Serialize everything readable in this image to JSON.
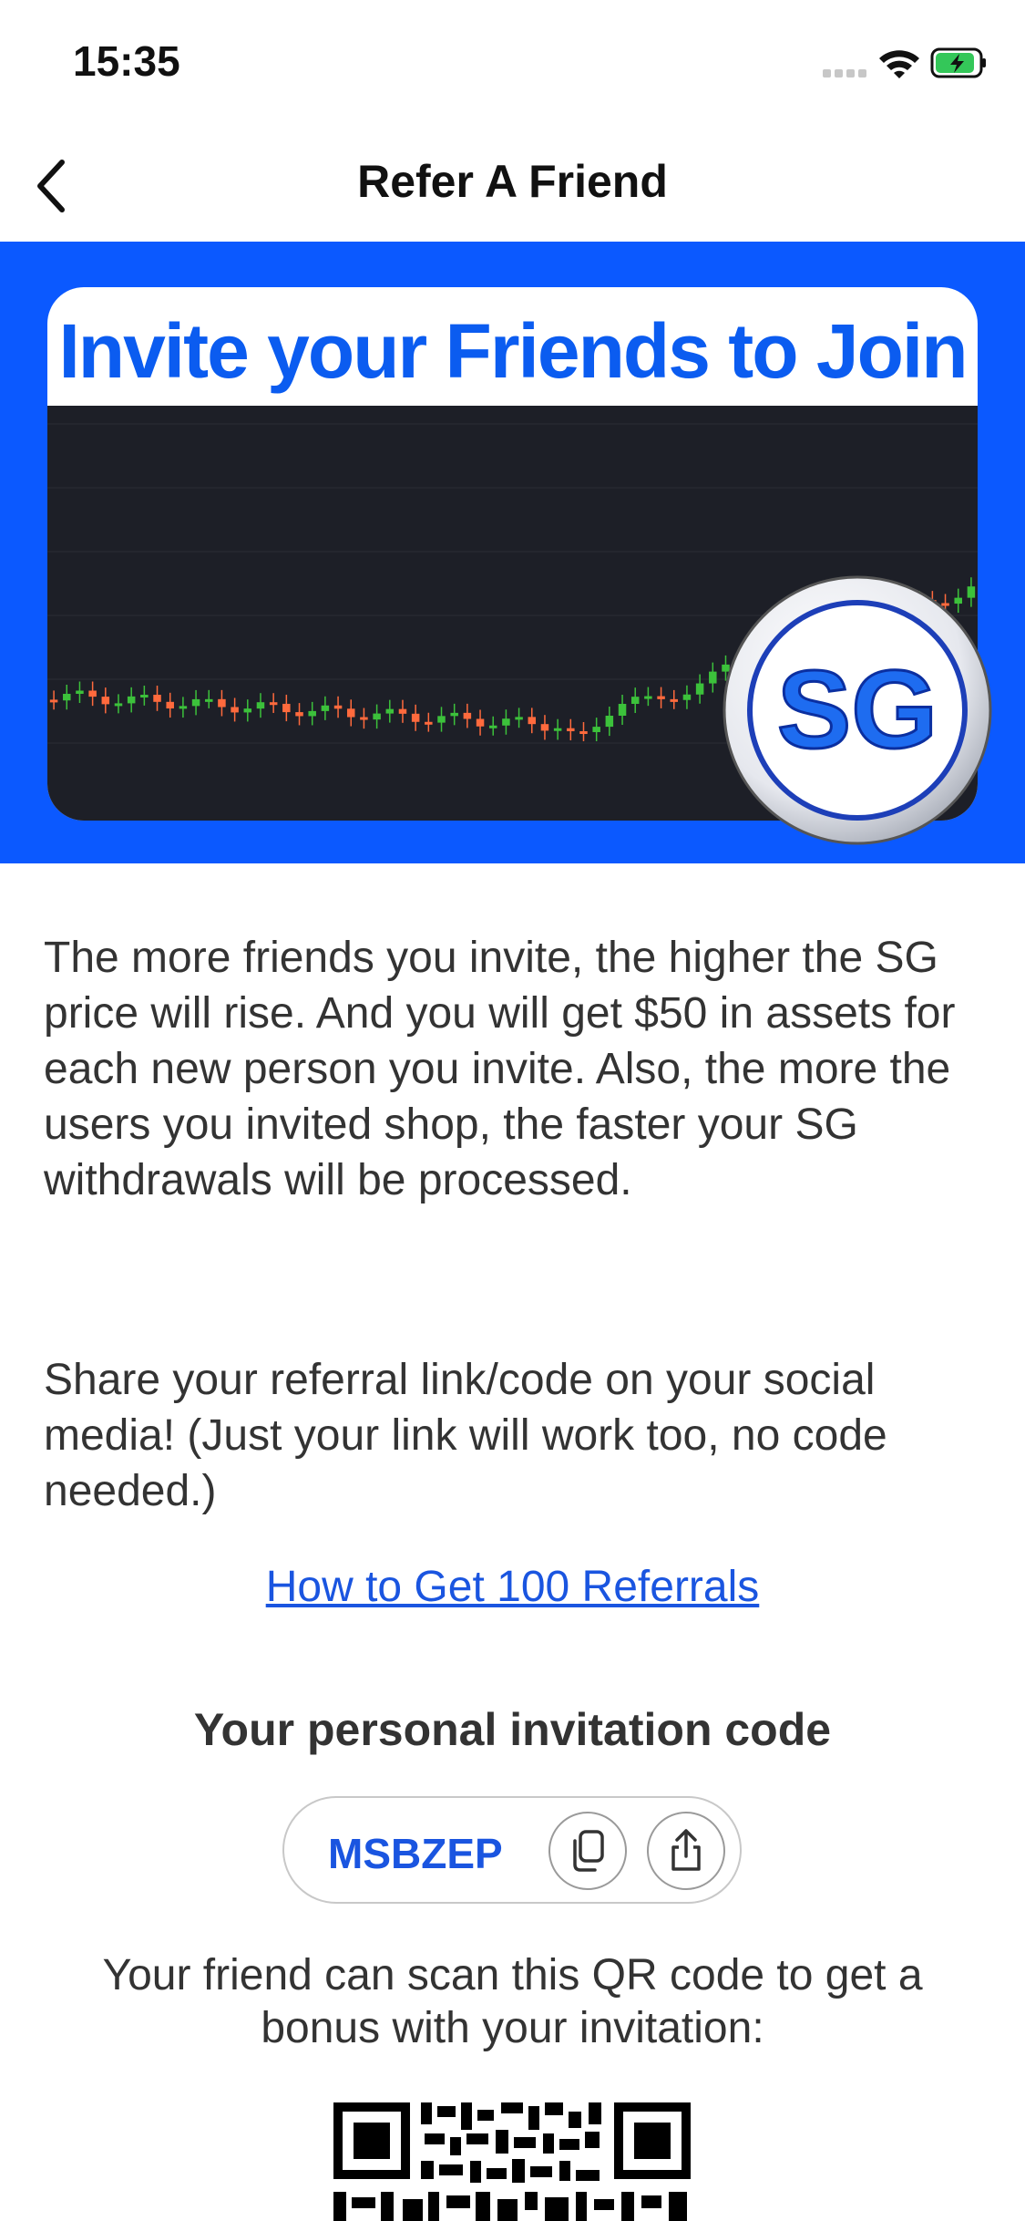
{
  "status_bar": {
    "time": "15:35",
    "icons": [
      "signal-icon",
      "wifi-icon",
      "battery-charging-icon"
    ]
  },
  "nav": {
    "title": "Refer A Friend",
    "back_icon": "chevron-left-icon"
  },
  "banner": {
    "headline": "Invite your Friends to Join",
    "logo_text": "SG"
  },
  "content": {
    "paragraph_1": "The more friends you invite, the higher the SG price will rise. And you will get $50 in assets for each new person you invite. Also, the more the users you invited shop, the faster your SG withdrawals will be processed.",
    "paragraph_2": "Share your referral link/code on your social media! (Just your link will work too, no code needed.)",
    "referral_link": "How to Get 100 Referrals",
    "code_heading": "Your personal invitation code",
    "invitation_code": "MSBZEP",
    "qr_description": "Your friend can scan this QR code to get a bonus with your invitation:"
  },
  "colors": {
    "brand_blue": "#0b59ff",
    "link_blue": "#1a55e0",
    "headline_blue": "#0b5cf0",
    "chart_bg": "#1d1f27",
    "candle_up": "#3cc13b",
    "candle_down": "#ff6a3d"
  }
}
